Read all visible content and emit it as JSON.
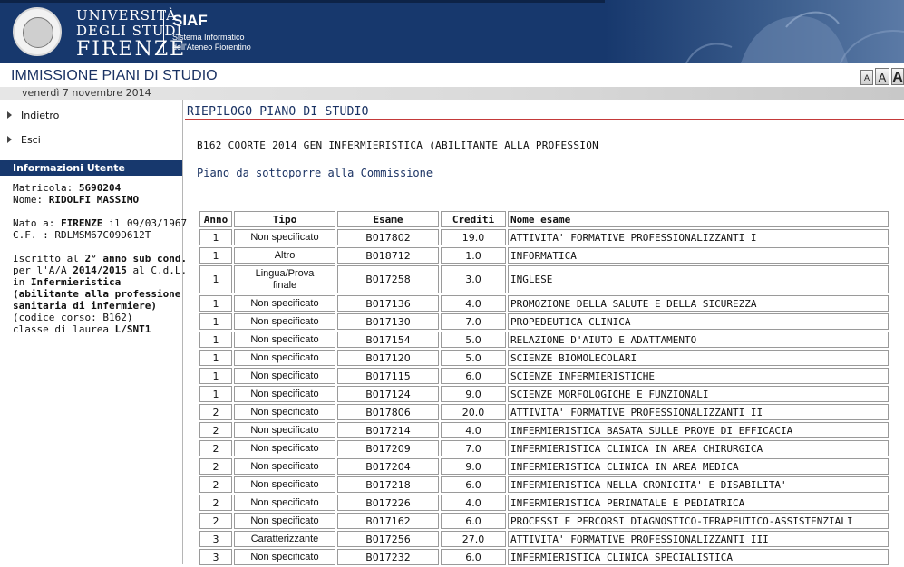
{
  "header": {
    "uni_line1": "UNIVERSITÀ",
    "uni_line2": "DEGLI STUDI",
    "uni_line3": "FIRENZE",
    "siaf_title": "SIAF",
    "siaf_sub1": "Sistema Informatico",
    "siaf_sub2": "dell'Ateneo Fiorentino",
    "brand_color": "#17386d"
  },
  "app": {
    "title": "IMMISSIONE PIANI DI STUDIO",
    "date": "venerdì 7 novembre 2014",
    "font_small": "A",
    "font_medium": "A",
    "font_large": "A"
  },
  "sidebar": {
    "nav": [
      {
        "label": "Indietro"
      },
      {
        "label": "Esci"
      }
    ],
    "info_title": "Informazioni Utente",
    "matricola_label": "Matricola:",
    "matricola": "5690204",
    "nome_label": "Nome:",
    "nome": "RIDOLFI MASSIMO",
    "nato_label": "Nato a:",
    "nato_luogo": "FIRENZE",
    "nato_il": "il 09/03/1967",
    "cf": "C.F. : RDLMSM67C09D612T",
    "iscritto_pre": "Iscritto al",
    "anno": "2° anno",
    "subcond": "sub cond.",
    "per_aa": "per l'A/A",
    "aa": "2014/2015",
    "al_cdl": "al C.d.L.",
    "in": "in",
    "corso_l1": "Infermieristica",
    "corso_l2": "(abilitante alla professione",
    "corso_l3": "sanitaria di infermiere)",
    "codice": "(codice corso: B162)",
    "classe_pre": "classe di laurea",
    "classe": "L/SNT1"
  },
  "main": {
    "section_title": "RIEPILOGO PIANO DI STUDIO",
    "course_line": "B162 COORTE 2014 GEN INFERMIERISTICA (ABILITANTE ALLA PROFESSION",
    "piano_label": "Piano da sottoporre alla Commissione",
    "columns": [
      "Anno",
      "Tipo",
      "Esame",
      "Crediti",
      "Nome esame"
    ],
    "rows": [
      {
        "anno": "1",
        "tipo": "Non specificato",
        "esame": "B017802",
        "crediti": "19.0",
        "nome": "ATTIVITA' FORMATIVE PROFESSIONALIZZANTI I"
      },
      {
        "anno": "1",
        "tipo": "Altro",
        "esame": "B018712",
        "crediti": "1.0",
        "nome": "INFORMATICA"
      },
      {
        "anno": "1",
        "tipo": "Lingua/Prova finale",
        "esame": "B017258",
        "crediti": "3.0",
        "nome": "INGLESE"
      },
      {
        "anno": "1",
        "tipo": "Non specificato",
        "esame": "B017136",
        "crediti": "4.0",
        "nome": "PROMOZIONE DELLA SALUTE E DELLA SICUREZZA"
      },
      {
        "anno": "1",
        "tipo": "Non specificato",
        "esame": "B017130",
        "crediti": "7.0",
        "nome": "PROPEDEUTICA CLINICA"
      },
      {
        "anno": "1",
        "tipo": "Non specificato",
        "esame": "B017154",
        "crediti": "5.0",
        "nome": "RELAZIONE D'AIUTO E ADATTAMENTO"
      },
      {
        "anno": "1",
        "tipo": "Non specificato",
        "esame": "B017120",
        "crediti": "5.0",
        "nome": "SCIENZE BIOMOLECOLARI"
      },
      {
        "anno": "1",
        "tipo": "Non specificato",
        "esame": "B017115",
        "crediti": "6.0",
        "nome": "SCIENZE INFERMIERISTICHE"
      },
      {
        "anno": "1",
        "tipo": "Non specificato",
        "esame": "B017124",
        "crediti": "9.0",
        "nome": "SCIENZE MORFOLOGICHE E FUNZIONALI"
      },
      {
        "anno": "2",
        "tipo": "Non specificato",
        "esame": "B017806",
        "crediti": "20.0",
        "nome": "ATTIVITA' FORMATIVE PROFESSIONALIZZANTI II"
      },
      {
        "anno": "2",
        "tipo": "Non specificato",
        "esame": "B017214",
        "crediti": "4.0",
        "nome": "INFERMIERISTICA BASATA SULLE PROVE DI EFFICACIA"
      },
      {
        "anno": "2",
        "tipo": "Non specificato",
        "esame": "B017209",
        "crediti": "7.0",
        "nome": "INFERMIERISTICA CLINICA IN AREA CHIRURGICA"
      },
      {
        "anno": "2",
        "tipo": "Non specificato",
        "esame": "B017204",
        "crediti": "9.0",
        "nome": "INFERMIERISTICA CLINICA IN AREA MEDICA"
      },
      {
        "anno": "2",
        "tipo": "Non specificato",
        "esame": "B017218",
        "crediti": "6.0",
        "nome": "INFERMIERISTICA NELLA CRONICITA' E DISABILITA'"
      },
      {
        "anno": "2",
        "tipo": "Non specificato",
        "esame": "B017226",
        "crediti": "4.0",
        "nome": "INFERMIERISTICA PERINATALE E PEDIATRICA"
      },
      {
        "anno": "2",
        "tipo": "Non specificato",
        "esame": "B017162",
        "crediti": "6.0",
        "nome": "PROCESSI E PERCORSI DIAGNOSTICO-TERAPEUTICO-ASSISTENZIALI"
      },
      {
        "anno": "3",
        "tipo": "Caratterizzante",
        "esame": "B017256",
        "crediti": "27.0",
        "nome": "ATTIVITA' FORMATIVE PROFESSIONALIZZANTI III"
      },
      {
        "anno": "3",
        "tipo": "Non specificato",
        "esame": "B017232",
        "crediti": "6.0",
        "nome": "INFERMIERISTICA CLINICA SPECIALISTICA"
      }
    ]
  }
}
